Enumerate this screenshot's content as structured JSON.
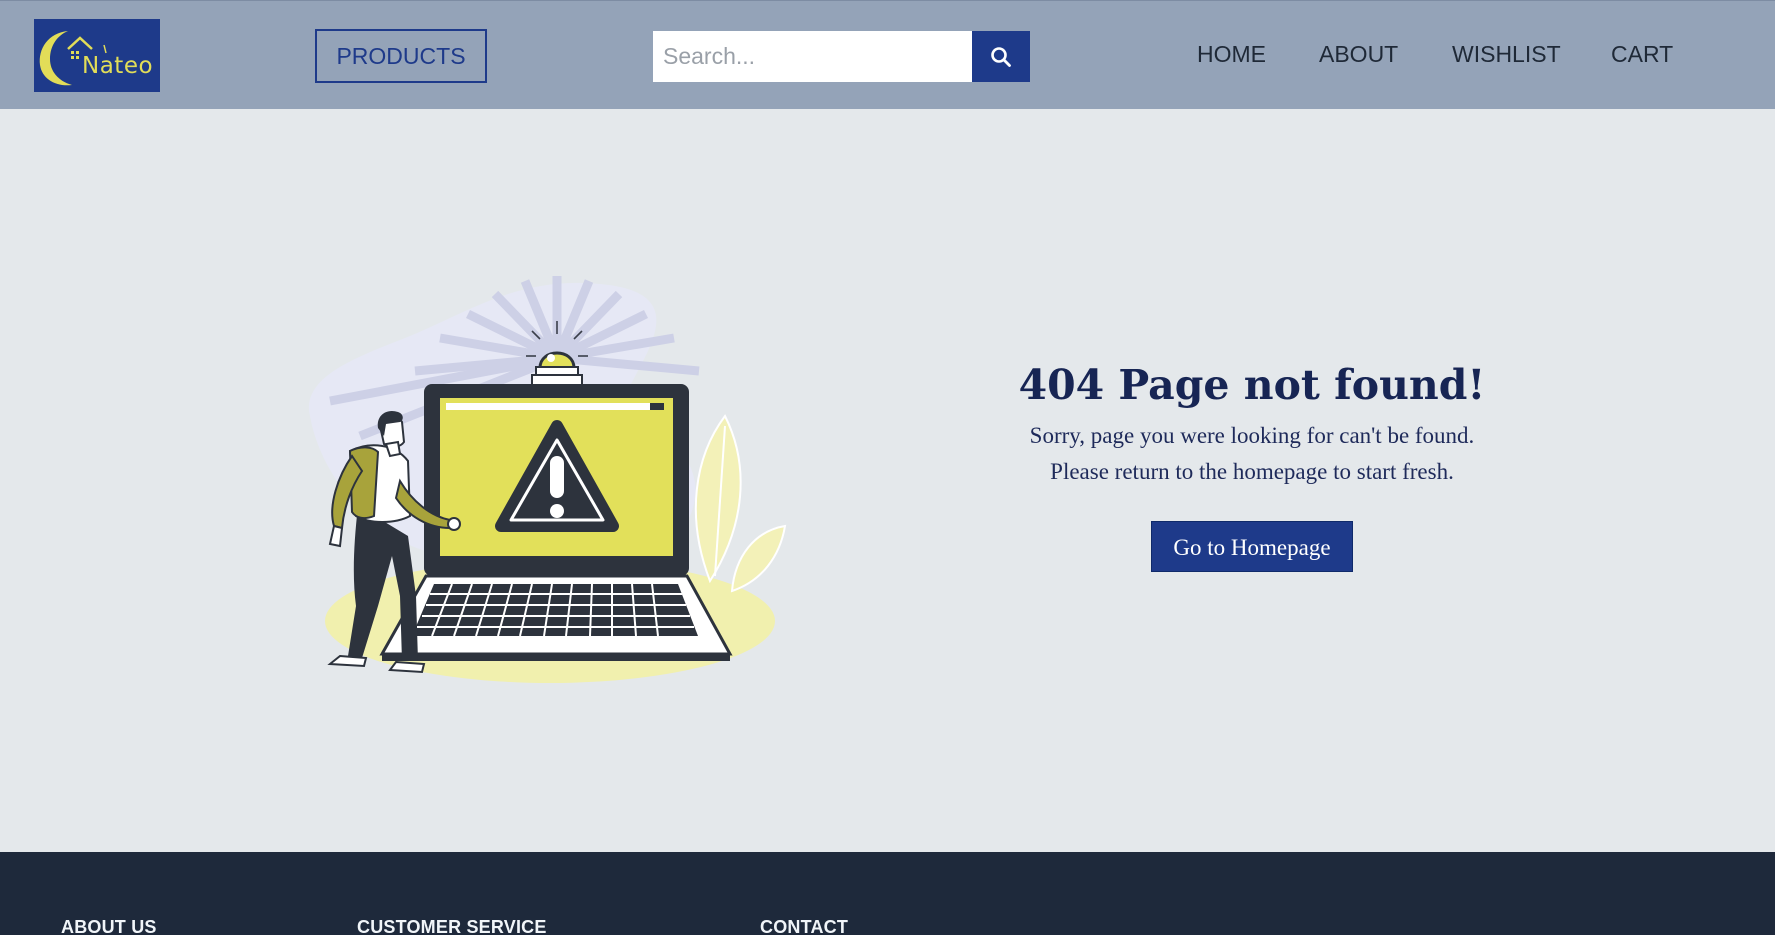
{
  "header": {
    "logo_text": "Nateo",
    "products_label": "PRODUCTS",
    "search": {
      "placeholder": "Search..."
    },
    "nav": [
      "HOME",
      "ABOUT",
      "WISHLIST",
      "CART"
    ]
  },
  "error": {
    "title": "404 Page not found!",
    "line1": "Sorry, page you were looking for can't be found.",
    "line2": "Please return to the homepage to start fresh.",
    "button_label": "Go to Homepage"
  },
  "footer": {
    "headings": [
      "ABOUT US",
      "CUSTOMER SERVICE",
      "CONTACT"
    ]
  },
  "icons": {
    "logo": "house-moon-logo-icon",
    "search": "search-icon",
    "illustration": "404-laptop-warning-illustration"
  },
  "colors": {
    "navbar": "#94a3b8",
    "primary": "#1e3a8a",
    "background": "#e4e8eb",
    "footer": "#1e293b",
    "accent_yellow": "#e2e05a"
  }
}
